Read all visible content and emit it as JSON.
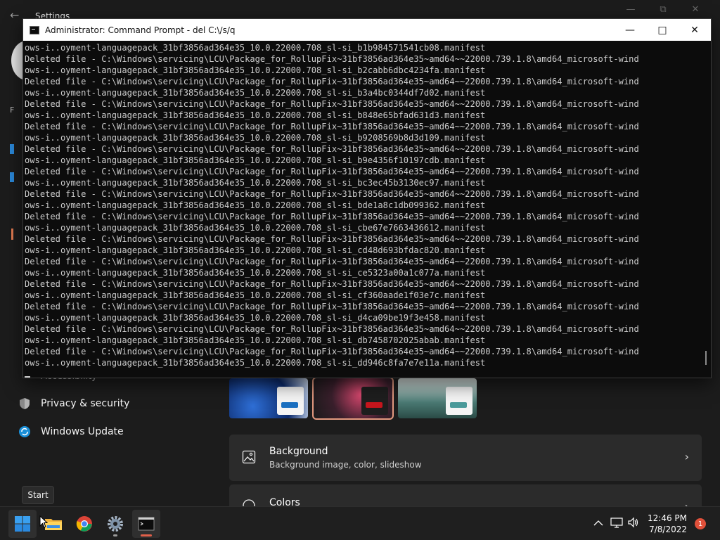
{
  "settings": {
    "title": "Settings",
    "side_peek_letter": "F",
    "nav": [
      {
        "label": "Accessibility"
      },
      {
        "label": "Privacy & security"
      },
      {
        "label": "Windows Update"
      }
    ],
    "cards": [
      {
        "title": "Background",
        "subtitle": "Background image, color, slideshow"
      },
      {
        "title": "Colors",
        "subtitle": ""
      }
    ]
  },
  "cmd": {
    "title": "Administrator: Command Prompt - del  C:\\/s/q",
    "prefix": "Deleted file - C:\\Windows\\servicing\\LCU\\Package_for_RollupFix~31bf3856ad364e35~amd64~~22000.739.1.8\\amd64_microsoft-wind",
    "cont_prefix": "ows-i..oyment-languagepack_31bf3856ad364e35_10.0.22000.708_sl-si_",
    "hashes": [
      "b1b984571541cb08",
      "b2cabb6dbc4234fa",
      "b3a4bc0344df7d02",
      "b848e65bfad631d3",
      "b9208569b8d3d109",
      "b9e4356f10197cdb",
      "bc3ec45b3130ec97",
      "bde1a8c1db099362",
      "cbe67e7663436612",
      "cd48d693bfdac820",
      "ce5323a00a1c077a",
      "cf360aade1f03e7c",
      "d4ca09be19f3e458",
      "db7458702025abab",
      "dd946c8fa7e7e11a"
    ],
    "suffix": ".manifest"
  },
  "tooltip": {
    "text": "Start"
  },
  "taskbar": {
    "clock_time": "12:46 PM",
    "clock_date": "7/8/2022",
    "notification_count": "1",
    "accent": "#0078d4"
  }
}
